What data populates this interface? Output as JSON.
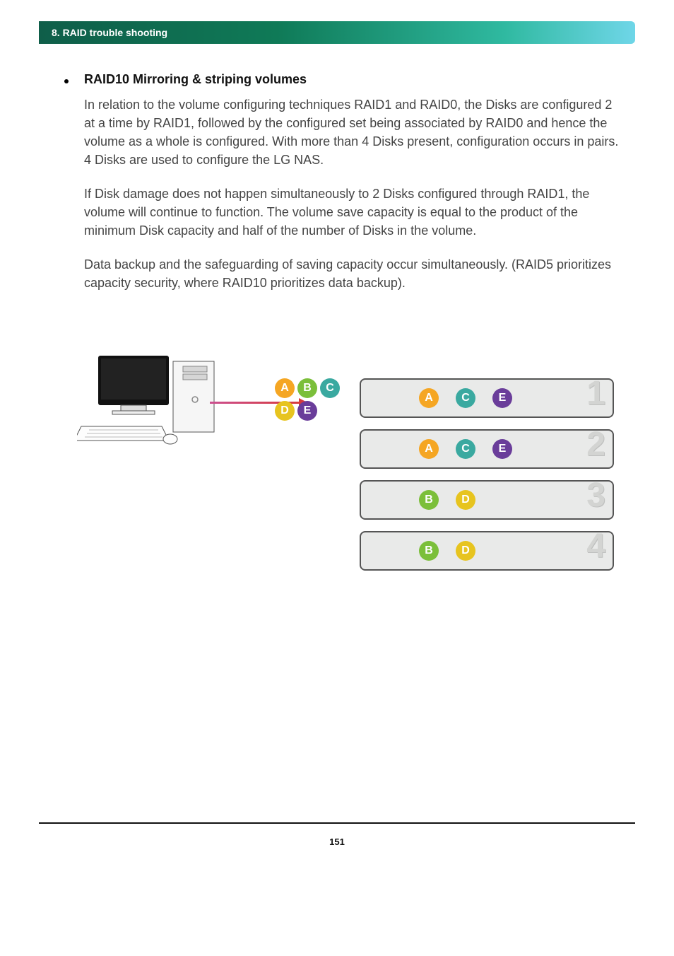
{
  "header": {
    "title": "8. RAID trouble shooting"
  },
  "section": {
    "bullet_title": "RAID10 Mirroring & striping volumes",
    "para1": "In relation to the volume configuring techniques RAID1 and RAID0, the Disks are configured 2 at a time by RAID1, followed by the configured set being associated by RAID0 and hence the volume as a whole is configured. With more than 4 Disks present, configuration occurs in pairs. 4 Disks are used to configure the LG NAS.",
    "para2": "If Disk damage does not happen simultaneously to 2 Disks configured through RAID1, the volume will continue to function. The volume save capacity is equal to the product of the minimum Disk capacity and half of the number of Disks in the volume.",
    "para3": "Data backup and the safeguarding of saving capacity occur simultaneously. (RAID5 prioritizes capacity security, where RAID10 prioritizes data backup)."
  },
  "diagram": {
    "source_letters": {
      "row1": [
        {
          "label": "A",
          "color": "orange"
        },
        {
          "label": "B",
          "color": "green"
        },
        {
          "label": "C",
          "color": "teal"
        }
      ],
      "row2": [
        {
          "label": "D",
          "color": "yellow"
        },
        {
          "label": "E",
          "color": "purple"
        }
      ]
    },
    "disks": [
      {
        "num": "1",
        "letters": [
          {
            "label": "A",
            "color": "orange"
          },
          {
            "label": "C",
            "color": "teal"
          },
          {
            "label": "E",
            "color": "purple"
          }
        ]
      },
      {
        "num": "2",
        "letters": [
          {
            "label": "A",
            "color": "orange"
          },
          {
            "label": "C",
            "color": "teal"
          },
          {
            "label": "E",
            "color": "purple"
          }
        ]
      },
      {
        "num": "3",
        "letters": [
          {
            "label": "B",
            "color": "green"
          },
          {
            "label": "D",
            "color": "yellow"
          }
        ]
      },
      {
        "num": "4",
        "letters": [
          {
            "label": "B",
            "color": "green"
          },
          {
            "label": "D",
            "color": "yellow"
          }
        ]
      }
    ]
  },
  "page_number": "151",
  "colors": {
    "orange": "#f5a623",
    "green": "#7bbf3a",
    "teal": "#3aa9a0",
    "yellow": "#e7c41f",
    "purple": "#6a3d9a"
  }
}
